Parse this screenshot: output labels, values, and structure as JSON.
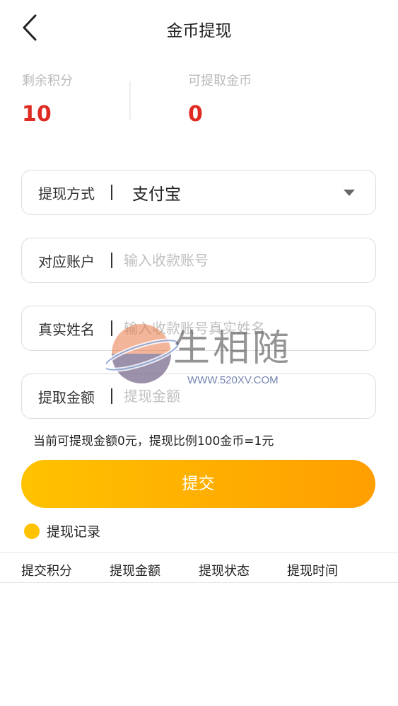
{
  "header": {
    "title": "金币提现"
  },
  "stats": [
    {
      "label": "剩余积分",
      "value": "10"
    },
    {
      "label": "可提取金币",
      "value": "0"
    }
  ],
  "form": {
    "method": {
      "label": "提现方式",
      "value": "支付宝"
    },
    "account": {
      "label": "对应账户",
      "placeholder": "输入收款账号"
    },
    "name": {
      "label": "真实姓名",
      "placeholder": "输入收款账号真实姓名"
    },
    "amount": {
      "label": "提取金额",
      "placeholder": "提现金额"
    }
  },
  "hint": "当前可提现金额0元，提现比例100金币=1元",
  "submit_label": "提交",
  "records": {
    "title": "提现记录",
    "columns": [
      "提交积分",
      "提现金额",
      "提现状态",
      "提现时间"
    ]
  },
  "watermark": {
    "text": "生相随",
    "url": "WWW.520XV.COM"
  },
  "colors": {
    "accent_red": "#e02b22",
    "button_start": "#ffc200",
    "button_end": "#ff9e00"
  }
}
